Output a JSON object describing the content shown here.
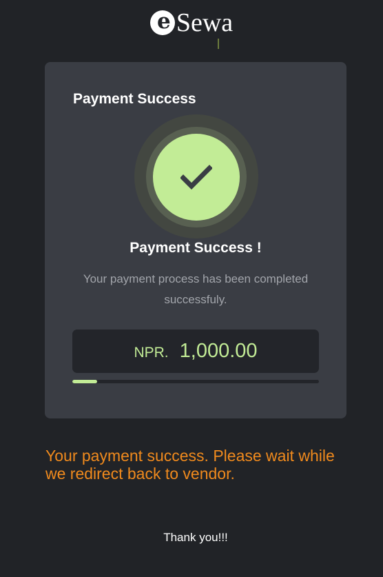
{
  "brand": {
    "logo_mark_letter": "e",
    "logo_text": "Sewa"
  },
  "card": {
    "heading": "Payment Success",
    "icon": "check-icon",
    "success_title": "Payment Success !",
    "success_description": "Your payment process has been completed successfuly.",
    "currency_label": "NPR.",
    "amount": "1,000.00",
    "redirect_progress": 0.1
  },
  "redirect_message": "Your payment success. Please wait while we redirect back to vendor.",
  "thanks": "Thank you!!!",
  "colors": {
    "background": "#212327",
    "card": "#3a3d44",
    "accent_green": "#c2ec96",
    "message_orange": "#f08a1d"
  }
}
